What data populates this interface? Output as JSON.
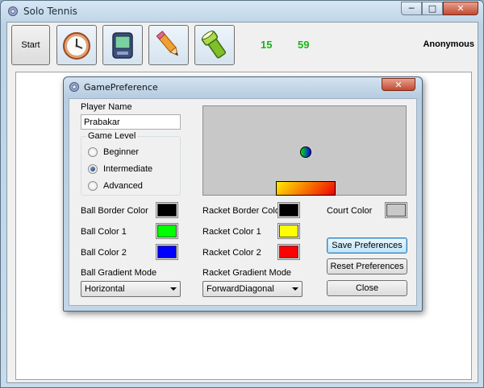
{
  "window": {
    "title": "Solo Tennis"
  },
  "toolbar": {
    "start_label": "Start",
    "tools": [
      {
        "icon": "clock-icon"
      },
      {
        "icon": "handheld-device-icon"
      },
      {
        "icon": "pencil-icon"
      },
      {
        "icon": "flashlight-icon"
      }
    ],
    "score_left": "15",
    "score_right": "59",
    "player_name": "Anonymous"
  },
  "dialog": {
    "title": "GamePreference",
    "player_name_label": "Player Name",
    "player_name_value": "Prabakar",
    "game_level": {
      "title": "Game Level",
      "options": [
        "Beginner",
        "Intermediate",
        "Advanced"
      ],
      "selected": "Intermediate"
    },
    "ball_border_color_label": "Ball Border Color",
    "ball_color1_label": "Ball Color 1",
    "ball_color2_label": "Ball Color 2",
    "ball_gradient_mode_label": "Ball Gradient Mode",
    "ball_gradient_mode_value": "Horizontal",
    "racket_border_color_label": "Racket Border Color",
    "racket_color1_label": "Racket Color 1",
    "racket_color2_label": "Racket Color 2",
    "racket_gradient_mode_label": "Racket Gradient Mode",
    "racket_gradient_mode_value": "ForwardDiagonal",
    "court_color_label": "Court Color",
    "save_label": "Save Preferences",
    "reset_label": "Reset Preferences",
    "close_label": "Close"
  },
  "colors": {
    "ball_border": "#000000",
    "ball_color1": "#00ff00",
    "ball_color2": "#0000ff",
    "racket_border": "#000000",
    "racket_color1": "#ffff00",
    "racket_color2": "#ff0000",
    "court": "#c8c8c8",
    "score": "#19b319"
  }
}
